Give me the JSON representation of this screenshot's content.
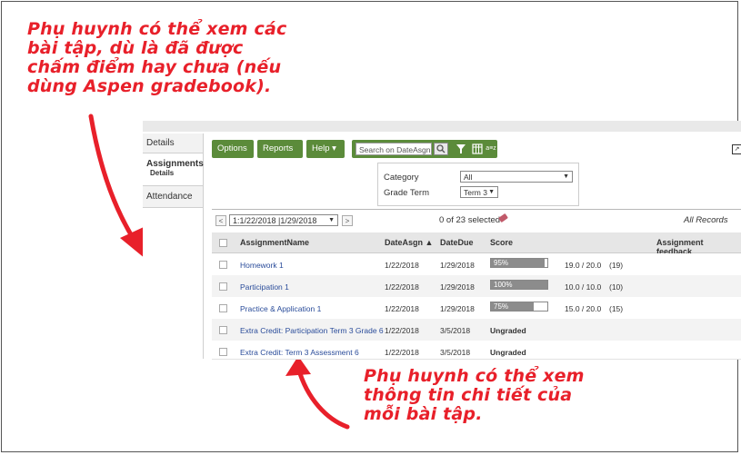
{
  "callouts": {
    "top": "Phụ huynh có thể xem các\nbài tập, dù là đã được\nchấm điểm hay chưa (nếu\ndùng Aspen gradebook).",
    "bottom": "Phụ huynh có thể xem\nthông tin chi tiết của\nmỗi bài tập."
  },
  "sidebar": {
    "tabs": [
      {
        "label": "Details"
      },
      {
        "label": "Assignments",
        "sub": "Details"
      },
      {
        "label": "Attendance"
      }
    ]
  },
  "toolbar": {
    "options": "Options ▾",
    "reports": "Reports ▾",
    "help": "Help ▾",
    "search_placeholder": "Search on DateAsgn",
    "sort_icon_text": "a≡z",
    "export_icon_text": "↗"
  },
  "filters": {
    "category_label": "Category",
    "category_value": "All",
    "grade_term_label": "Grade Term",
    "grade_term_value": "Term 3"
  },
  "pager": {
    "prev": "<",
    "next": ">",
    "date_range": "1:1/22/2018 |1/29/2018",
    "selected": "0 of 23 selected",
    "all_records": "All Records"
  },
  "table": {
    "columns": [
      "AssignmentName",
      "DateAsgn ▲",
      "DateDue",
      "Score",
      "Assignment feedback"
    ],
    "rows": [
      {
        "name": "Homework 1",
        "asgn": "1/22/2018",
        "due": "1/29/2018",
        "pct": "95%",
        "pct_value": 95,
        "score": "19.0 / 20.0",
        "points": "(19)"
      },
      {
        "name": "Participation 1",
        "asgn": "1/22/2018",
        "due": "1/29/2018",
        "pct": "100%",
        "pct_value": 100,
        "score": "10.0 / 10.0",
        "points": "(10)"
      },
      {
        "name": "Practice & Application 1",
        "asgn": "1/22/2018",
        "due": "1/29/2018",
        "pct": "75%",
        "pct_value": 75,
        "score": "15.0 / 20.0",
        "points": "(15)"
      },
      {
        "name": "Extra Credit: Participation Term 3 Grade 6",
        "asgn": "1/22/2018",
        "due": "3/5/2018",
        "ungraded": "Ungraded"
      },
      {
        "name": "Extra Credit: Term 3 Assessment 6",
        "asgn": "1/22/2018",
        "due": "3/5/2018",
        "ungraded": "Ungraded"
      }
    ]
  },
  "colors": {
    "annotation_red": "#e8202a",
    "toolbar_green": "#5b8b3a",
    "link_blue": "#2a4c9a"
  }
}
